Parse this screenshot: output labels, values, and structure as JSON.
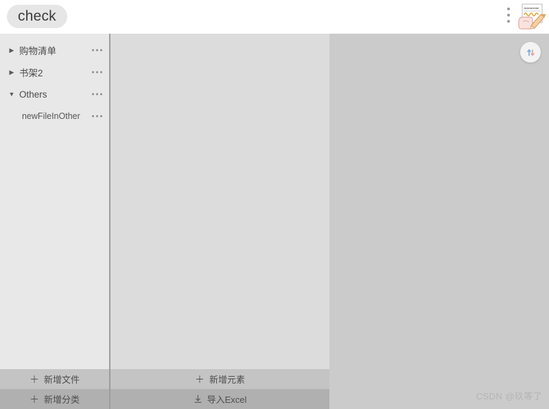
{
  "header": {
    "title": "check",
    "menu_icon": "vertical-dots-icon",
    "signature_icon": "handwriting-signature-icon"
  },
  "sidebar": {
    "items": [
      {
        "label": "购物清单",
        "caret": "▶",
        "level": 0,
        "expanded": false,
        "more": "•••"
      },
      {
        "label": "书架2",
        "caret": "▶",
        "level": 0,
        "expanded": false,
        "more": "•••"
      },
      {
        "label": "Others",
        "caret": "▼",
        "level": 0,
        "expanded": true,
        "more": "•••"
      },
      {
        "label": "newFileInOther",
        "caret": "",
        "level": 1,
        "expanded": false,
        "more": "•••"
      }
    ]
  },
  "panel_right": {
    "round_button_icon": "sync-icon"
  },
  "actions": {
    "row1": {
      "left": {
        "icon": "plus-icon",
        "label": "新增文件"
      },
      "right": {
        "icon": "plus-icon",
        "label": "新增元素"
      }
    },
    "row2": {
      "left": {
        "icon": "plus-icon",
        "label": "新增分类"
      },
      "right": {
        "icon": "download-icon",
        "label": "导入Excel"
      }
    }
  },
  "watermark": {
    "text": "CSDN @玖等了"
  },
  "colors": {
    "header_bg": "#ffffff",
    "sidebar_bg": "#e8e8e8",
    "middle_bg": "#dcdcdc",
    "right_bg": "#cbcbcb",
    "divider": "#9c9c9c",
    "action_row1_bg": "#c4c4c4",
    "action_row2_bg": "#b0b0b0",
    "title_pill_bg": "#e6e6e6",
    "text": "#4a4a4a",
    "watermark": "#b4b4b4"
  }
}
